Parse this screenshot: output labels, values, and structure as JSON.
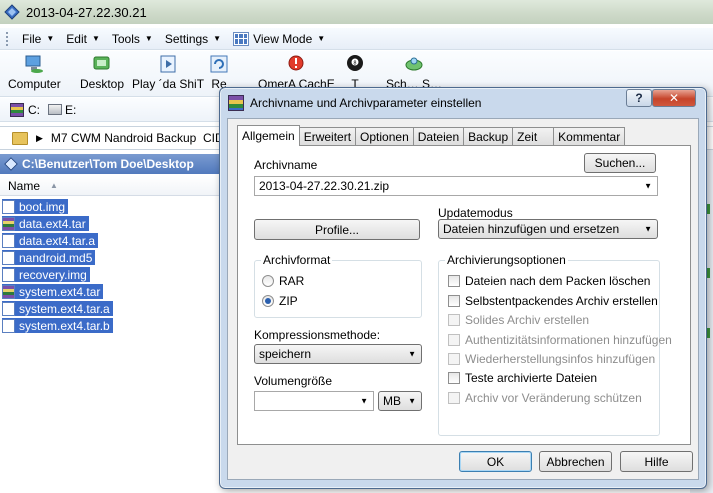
{
  "background_window": {
    "title": "2013-04-27.22.30.21",
    "menu": [
      {
        "label": "File"
      },
      {
        "label": "Edit"
      },
      {
        "label": "Tools"
      },
      {
        "label": "Settings"
      },
      {
        "label": "View Mode"
      }
    ],
    "toolbar": [
      {
        "label": "Computer",
        "icon": "computer-icon"
      },
      {
        "label": "Desktop",
        "icon": "desktop-icon"
      },
      {
        "label": "Play ´da ShiT",
        "icon": "media-icon"
      },
      {
        "label": "Re",
        "icon": "refresh-icon"
      },
      {
        "label": "OmerA CachE",
        "icon": "cache-icon"
      },
      {
        "label": "T",
        "icon": "eight-ball-icon"
      },
      {
        "label": "Sch…   S…",
        "icon": "search-tool-icon"
      }
    ],
    "drives": [
      {
        "label": "C:"
      },
      {
        "label": "E:"
      }
    ],
    "path": "M7 CWM Nandroid Backup  CID",
    "panel_path": "C:\\Benutzer\\Tom Doe\\Desktop",
    "column_name": "Name",
    "files": [
      {
        "name": "boot.img",
        "icon": "file-icon"
      },
      {
        "name": "data.ext4.tar",
        "icon": "rar-file-icon"
      },
      {
        "name": "data.ext4.tar.a",
        "icon": "file-icon"
      },
      {
        "name": "nandroid.md5",
        "icon": "file-icon"
      },
      {
        "name": "recovery.img",
        "icon": "file-icon"
      },
      {
        "name": "system.ext4.tar",
        "icon": "rar-file-icon"
      },
      {
        "name": "system.ext4.tar.a",
        "icon": "file-icon"
      },
      {
        "name": "system.ext4.tar.b",
        "icon": "file-icon"
      }
    ]
  },
  "dialog": {
    "title": "Archivname und Archivparameter einstellen",
    "help_label": "?",
    "close_label": "✕",
    "tabs": [
      {
        "label": "Allgemein",
        "active": true
      },
      {
        "label": "Erweitert"
      },
      {
        "label": "Optionen"
      },
      {
        "label": "Dateien"
      },
      {
        "label": "Backup"
      },
      {
        "label": "Zeit"
      },
      {
        "label": "Kommentar"
      }
    ],
    "archivname_label": "Archivname",
    "suchen_label": "Suchen...",
    "archivname_value": "2013-04-27.22.30.21.zip",
    "updatemodus_label": "Updatemodus",
    "updatemodus_value": "Dateien hinzufügen und ersetzen",
    "profile_label": "Profile...",
    "archivformat_label": "Archivformat",
    "format_options": [
      {
        "label": "RAR",
        "selected": false
      },
      {
        "label": "ZIP",
        "selected": true
      }
    ],
    "optionen_label": "Archivierungsoptionen",
    "options": [
      {
        "label": "Dateien nach dem Packen löschen",
        "checked": false,
        "enabled": true
      },
      {
        "label": "Selbstentpackendes Archiv erstellen",
        "checked": false,
        "enabled": true
      },
      {
        "label": "Solides Archiv erstellen",
        "checked": false,
        "enabled": false
      },
      {
        "label": "Authentizitätsinformationen hinzufügen",
        "checked": false,
        "enabled": false
      },
      {
        "label": "Wiederherstellungsinfos hinzufügen",
        "checked": false,
        "enabled": false
      },
      {
        "label": "Teste archivierte Dateien",
        "checked": false,
        "enabled": true
      },
      {
        "label": "Archiv vor Veränderung schützen",
        "checked": false,
        "enabled": false
      }
    ],
    "kompression_label": "Kompressionsmethode:",
    "kompression_value": "speichern",
    "volumen_label": "Volumengröße",
    "volumen_value": "",
    "volumen_unit": "MB",
    "ok_label": "OK",
    "abbrechen_label": "Abbrechen",
    "hilfe_label": "Hilfe"
  },
  "colors": {
    "selection": "#3b6bc8",
    "panel_header": "#5179bd",
    "dialog_frame": "#c9d9ec",
    "close_red": "#c6442a"
  }
}
